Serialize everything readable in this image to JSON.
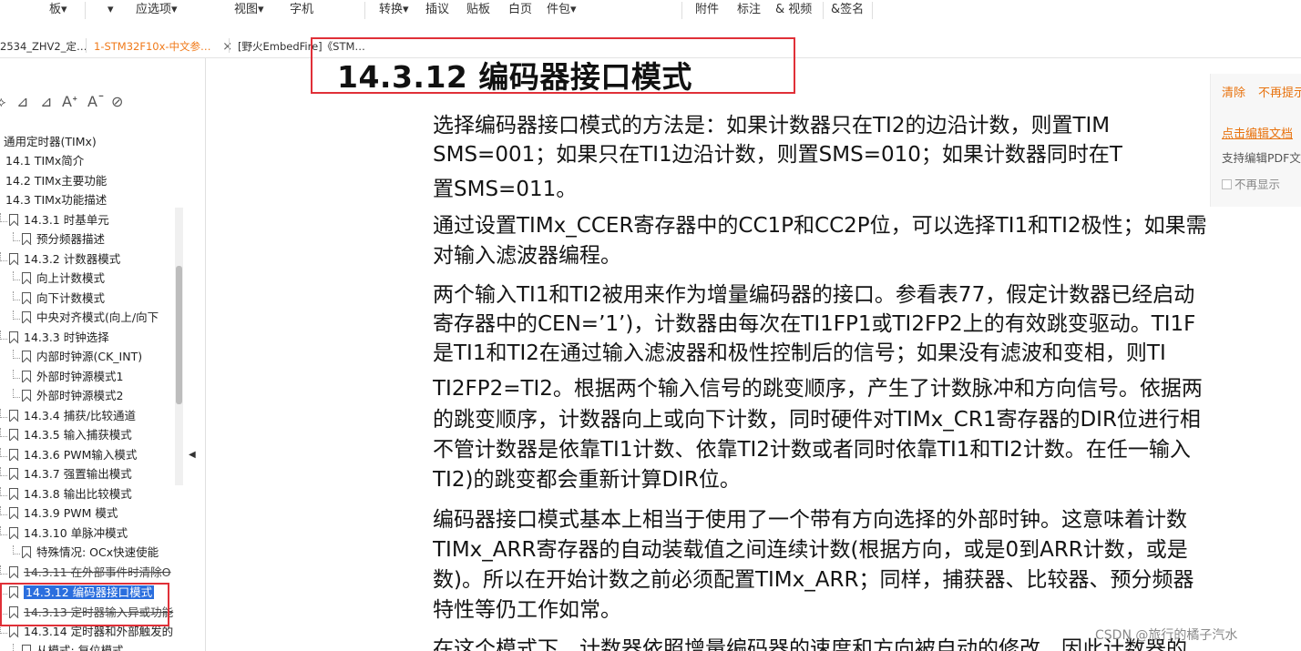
{
  "toolbar": {
    "items": [
      "板▾",
      "▾",
      "应选项▾",
      "视图▾",
      "字机",
      "转换▾",
      "插议",
      "贴板",
      "白页",
      "件包▾",
      "附件",
      "标注",
      "& 视频",
      "&签名"
    ]
  },
  "tabs": [
    {
      "label": "2534_ZHV2_定…",
      "close": "×"
    },
    {
      "label": "1-STM32F10x-中文参…",
      "close": "×"
    },
    {
      "label": "[野火EmbedFire]《STM…",
      "close": ""
    }
  ],
  "left_tools": [
    "⟡",
    "⊿",
    "⊿",
    "Aᐩ",
    "Aˉ",
    "⊘"
  ],
  "outline": [
    {
      "label": "通用定时器(TIMx)",
      "level": 0
    },
    {
      "label": "14.1 TIMx简介",
      "level": 0
    },
    {
      "label": "14.2 TIMx主要功能",
      "level": 0
    },
    {
      "label": "14.3 TIMx功能描述",
      "level": 0
    },
    {
      "label": "14.3.1 时基单元",
      "level": 1
    },
    {
      "label": "预分频器描述",
      "level": 2
    },
    {
      "label": "14.3.2 计数器模式",
      "level": 1
    },
    {
      "label": "向上计数模式",
      "level": 2
    },
    {
      "label": "向下计数模式",
      "level": 2
    },
    {
      "label": "中央对齐模式(向上/向下",
      "level": 2
    },
    {
      "label": "14.3.3 时钟选择",
      "level": 1
    },
    {
      "label": "内部时钟源(CK_INT)",
      "level": 2
    },
    {
      "label": "外部时钟源模式1",
      "level": 2
    },
    {
      "label": "外部时钟源模式2",
      "level": 2
    },
    {
      "label": "14.3.4 捕获/比较通道",
      "level": 1
    },
    {
      "label": "14.3.5 输入捕获模式",
      "level": 1
    },
    {
      "label": "14.3.6 PWM输入模式",
      "level": 1
    },
    {
      "label": "14.3.7 强置输出模式",
      "level": 1
    },
    {
      "label": "14.3.8 输出比较模式",
      "level": 1
    },
    {
      "label": "14.3.9 PWM 模式",
      "level": 1
    },
    {
      "label": "14.3.10 单脉冲模式",
      "level": 1
    },
    {
      "label": "特殊情况: OCx快速使能",
      "level": 2
    },
    {
      "label": "14.3.11 在外部事件时清除O",
      "level": 1
    },
    {
      "label": "14.3.12 编码器接口模式",
      "level": 1
    },
    {
      "label": "14.3.13 定时器输入异或功能",
      "level": 1
    },
    {
      "label": "14.3.14 定时器和外部触发的",
      "level": 1
    },
    {
      "label": "从模式: 复位模式",
      "level": 2
    }
  ],
  "selected_outline_index": 23,
  "notice": {
    "clear": "清除",
    "no_more_hint": "不再提示",
    "edit_link": "点击编辑文档",
    "support_text": "支持编辑PDF文",
    "checkbox_label": "不再显示"
  },
  "document": {
    "heading": "14.3.12  编码器接口模式",
    "lines": [
      "选择编码器接口模式的方法是：如果计数器只在TI2的边沿计数，则置TIM",
      "SMS=001；如果只在TI1边沿计数，则置SMS=010；如果计数器同时在T",
      "置SMS=011。",
      "通过设置TIMx_CCER寄存器中的CC1P和CC2P位，可以选择TI1和TI2极性；如果需",
      "对输入滤波器编程。",
      "两个输入TI1和TI2被用来作为增量编码器的接口。参看表77，假定计数器已经启动",
      "寄存器中的CEN=’1’)，计数器由每次在TI1FP1或TI2FP2上的有效跳变驱动。TI1F",
      "是TI1和TI2在通过输入滤波器和极性控制后的信号；如果没有滤波和变相，则TI",
      "TI2FP2=TI2。根据两个输入信号的跳变顺序，产生了计数脉冲和方向信号。依据两",
      "的跳变顺序，计数器向上或向下计数，同时硬件对TIMx_CR1寄存器的DIR位进行相",
      "不管计数器是依靠TI1计数、依靠TI2计数或者同时依靠TI1和TI2计数。在任一输入",
      "TI2)的跳变都会重新计算DIR位。",
      "编码器接口模式基本上相当于使用了一个带有方向选择的外部时钟。这意味着计数",
      "TIMx_ARR寄存器的自动装载值之间连续计数(根据方向，或是0到ARR计数，或是",
      "数)。所以在开始计数之前必须配置TIMx_ARR；同样，捕获器、比较器、预分频器",
      "特性等仍工作如常。",
      "在这个模式下，计数器依照增量编码器的速度和方向被自动的修改，因此计数器的"
    ]
  },
  "watermark": "CSDN @旅行的橘子汽水",
  "colors": {
    "accent_orange": "#f07a1a",
    "selection_blue": "#2a6ede",
    "annotation_red": "#e03038",
    "link_orange": "#e8730f"
  }
}
